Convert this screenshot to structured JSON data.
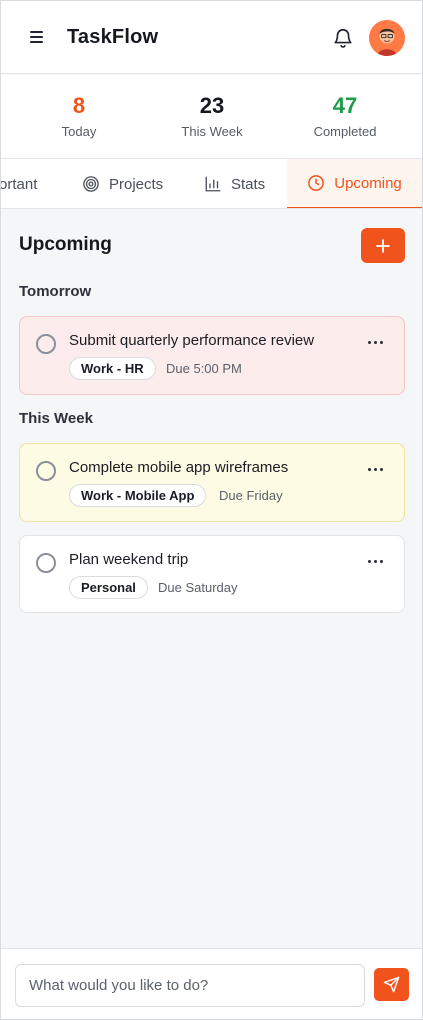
{
  "header": {
    "title": "TaskFlow",
    "menu_icon": "hamburger-menu-icon",
    "bell_icon": "bell-icon",
    "avatar": "user-avatar"
  },
  "stats": [
    {
      "value": "8",
      "label": "Today",
      "color": "#f0531c"
    },
    {
      "value": "23",
      "label": "This Week",
      "color": "#15181f"
    },
    {
      "value": "47",
      "label": "Completed",
      "color": "#1e9a4b"
    }
  ],
  "tabs": [
    {
      "label": "ortant",
      "icon": ""
    },
    {
      "label": "Projects",
      "icon": "target-icon"
    },
    {
      "label": "Stats",
      "icon": "bar-chart-icon"
    },
    {
      "label": "Upcoming",
      "icon": "clock-icon",
      "active": true
    }
  ],
  "main": {
    "title": "Upcoming",
    "add_icon": "plus-icon",
    "groups": [
      {
        "label": "Tomorrow",
        "tasks": [
          {
            "title": "Submit quarterly performance review",
            "tag": "Work - HR",
            "due": "Due 5:00 PM",
            "tone": "red"
          }
        ]
      },
      {
        "label": "This Week",
        "tasks": [
          {
            "title": "Complete mobile app wireframes",
            "tag": "Work - Mobile App",
            "due": "Due Friday",
            "tone": "yellow"
          },
          {
            "title": "Plan weekend trip",
            "tag": "Personal",
            "due": "Due Saturday",
            "tone": "white"
          }
        ]
      }
    ]
  },
  "composer": {
    "placeholder": "What would you like to do?",
    "send_icon": "send-icon"
  },
  "colors": {
    "accent": "#f0531c",
    "completed": "#1e9a4b",
    "urgent_bg": "#fdecec",
    "week_bg": "#fdfbe3"
  }
}
